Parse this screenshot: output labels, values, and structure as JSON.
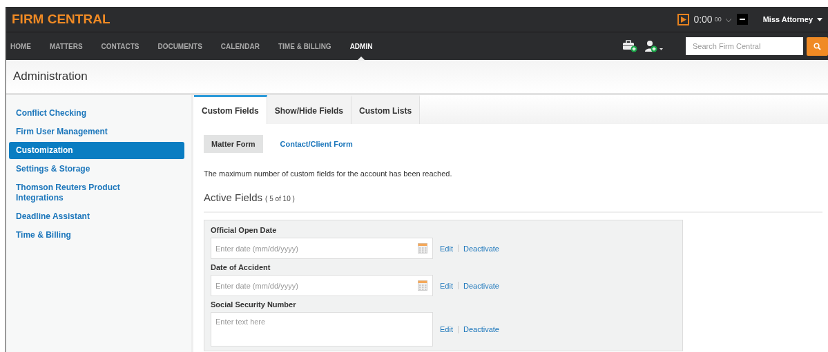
{
  "header": {
    "logo": "FIRM CENTRAL",
    "timer": "0:00",
    "timer_unit": "00",
    "user": "Miss Attorney"
  },
  "nav": [
    {
      "label": "HOME",
      "selected": false
    },
    {
      "label": "MATTERS",
      "selected": false
    },
    {
      "label": "CONTACTS",
      "selected": false
    },
    {
      "label": "DOCUMENTS",
      "selected": false
    },
    {
      "label": "CALENDAR",
      "selected": false
    },
    {
      "label": "TIME & BILLING",
      "selected": false
    },
    {
      "label": "ADMIN",
      "selected": true
    }
  ],
  "search": {
    "placeholder": "Search Firm Central"
  },
  "page_title": "Administration",
  "sidebar": {
    "items": [
      {
        "label": "Conflict Checking",
        "selected": false
      },
      {
        "label": "Firm User Management",
        "selected": false
      },
      {
        "label": "Customization",
        "selected": true
      },
      {
        "label": "Settings & Storage",
        "selected": false
      },
      {
        "label": "Thomson Reuters Product Integrations",
        "selected": false
      },
      {
        "label": "Deadline Assistant",
        "selected": false
      },
      {
        "label": "Time & Billing",
        "selected": false
      }
    ]
  },
  "tabs": [
    {
      "label": "Custom Fields",
      "selected": true
    },
    {
      "label": "Show/Hide Fields",
      "selected": false
    },
    {
      "label": "Custom Lists",
      "selected": false
    }
  ],
  "subtabs": [
    {
      "label": "Matter Form",
      "selected": true
    },
    {
      "label": "Contact/Client Form",
      "selected": false
    }
  ],
  "notice": "The maximum number of custom fields for the account has been reached.",
  "active_fields": {
    "title": "Active Fields",
    "count": "( 5 of 10 )"
  },
  "fields": [
    {
      "kind": "date",
      "label": "Official Open Date",
      "placeholder": "Enter date (mm/dd/yyyy)",
      "edit": "Edit",
      "deactivate": "Deactivate"
    },
    {
      "kind": "date",
      "label": "Date of Accident",
      "placeholder": "Enter date (mm/dd/yyyy)",
      "edit": "Edit",
      "deactivate": "Deactivate"
    },
    {
      "kind": "text",
      "label": "Social Security Number",
      "placeholder": "Enter text here",
      "edit": "Edit",
      "deactivate": "Deactivate"
    }
  ]
}
